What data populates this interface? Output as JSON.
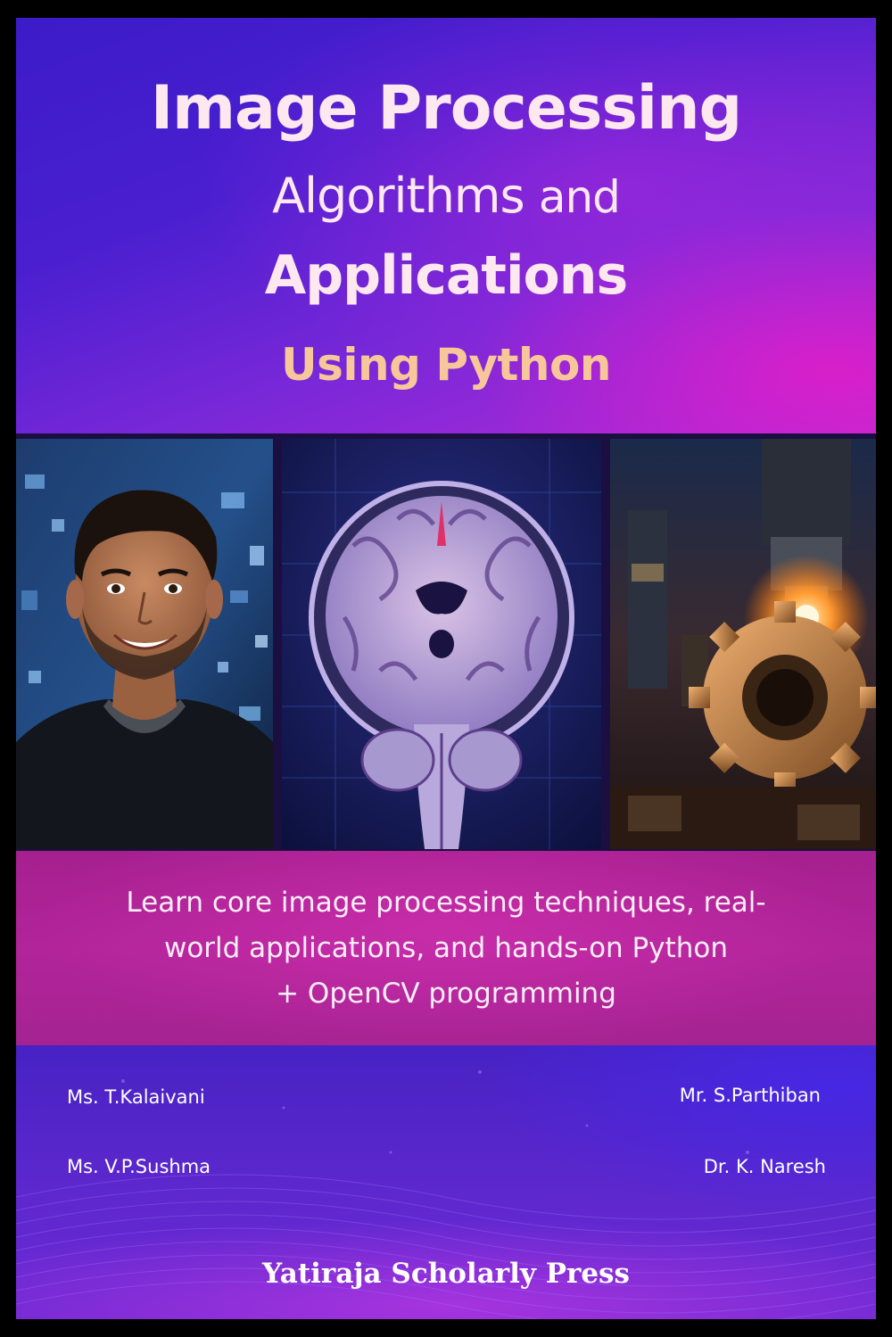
{
  "title": {
    "line1": "Image Processing",
    "line2_main": "Algorithms",
    "line2_and": "and",
    "line3": "Applications",
    "line4": "Using Python"
  },
  "photos": [
    {
      "name": "portrait-photo",
      "subject": "smiling man"
    },
    {
      "name": "brain-mri-photo",
      "subject": "brain MRI scan"
    },
    {
      "name": "industrial-gear-photo",
      "subject": "machine and gear"
    }
  ],
  "description": {
    "line1": "Learn core image processing techniques,  real-",
    "line2": "world applications, and hands-on Python",
    "line3": "+ OpenCV programming"
  },
  "authors": {
    "left": [
      "Ms. T.Kalaivani",
      "Ms. V.P.Sushma"
    ],
    "right": [
      "Mr. S.Parthiban",
      "Dr. K. Naresh"
    ]
  },
  "publisher": "Yatiraja Scholarly Press",
  "colors": {
    "title_text": "#fde8f0",
    "subtitle_text": "#f7c79a",
    "primary_purple": "#4a1fd0",
    "magenta": "#b2249a"
  }
}
